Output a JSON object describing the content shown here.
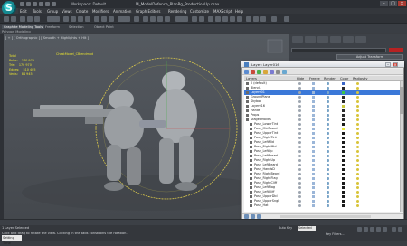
{
  "app": {
    "logo_letter": "S",
    "workspace": "Workspace: Default",
    "title": "M_ModelDefence_PlanPg_ProductionUp.max"
  },
  "menu": [
    "Edit",
    "Tools",
    "Group",
    "Views",
    "Create",
    "Modifiers",
    "Animation",
    "Graph Editors",
    "Rendering",
    "Customize",
    "MAXScript",
    "Help"
  ],
  "ribbon": {
    "tabs": [
      "Graphite Modeling Tools",
      "Freeform",
      "Selection",
      "Object Paint"
    ],
    "active": 0,
    "sublabel": "Polygon Modeling"
  },
  "viewport": {
    "label": "[ + ] [ Orthographic ] [ Smooth + Highlights + Hlt ]",
    "object_name": "ChestModel_CBlendmod",
    "stats": [
      {
        "label": "Total",
        "value": ""
      },
      {
        "label": "Polys:",
        "value": "170 970"
      },
      {
        "label": "Tris:",
        "value": "170 970"
      },
      {
        "label": "Edges:",
        "value": "510 405"
      },
      {
        "label": "Verts:",
        "value": "84 945"
      }
    ]
  },
  "command_panel": {
    "adjust_button": "Adjust Transform"
  },
  "layer_window": {
    "title": "Layer: Layer016",
    "columns": [
      "Layers",
      "Hide",
      "Freeze",
      "Render",
      "Color",
      "Radiosity"
    ],
    "rows": [
      {
        "name": "0 (default)",
        "indent": 0,
        "color": "#3a66c8"
      },
      {
        "name": "Blend1",
        "indent": 0,
        "color": "#2a2a2a"
      },
      {
        "name": "Layer001",
        "indent": 0,
        "color": "#3ac84a",
        "selected": true
      },
      {
        "name": "GroundPlane",
        "indent": 0,
        "color": "#2a2a2a"
      },
      {
        "name": "Skybox",
        "indent": 0,
        "color": "#2a2a2a"
      },
      {
        "name": "Layer016",
        "indent": 0,
        "color": "#c8c83a"
      },
      {
        "name": "Hands",
        "indent": 0,
        "color": "#2a2a2a"
      },
      {
        "name": "Props",
        "indent": 0,
        "color": "#2a2a2a"
      },
      {
        "name": "StagedMoves",
        "indent": 0,
        "color": "#2a2a2a"
      },
      {
        "name": "Pose_LowerTint",
        "indent": 1,
        "color": "#1a1a1a"
      },
      {
        "name": "Pose_MidPosed",
        "indent": 1,
        "color": "#e8e83a"
      },
      {
        "name": "Pose_UpperTint",
        "indent": 1,
        "color": "#1a1a1a"
      },
      {
        "name": "Pose_RightTint",
        "indent": 1,
        "color": "#1a1a1a"
      },
      {
        "name": "Pose_LeftMid",
        "indent": 1,
        "color": "#1a1a1a"
      },
      {
        "name": "Pose_RightMid",
        "indent": 1,
        "color": "#1a1a1a"
      },
      {
        "name": "Pose_LeftUp",
        "indent": 1,
        "color": "#1a1a1a"
      },
      {
        "name": "Pose_LeftPosed",
        "indent": 1,
        "color": "#1a1a1a"
      },
      {
        "name": "Pose_RightUp",
        "indent": 1,
        "color": "#1a1a1a"
      },
      {
        "name": "Pose_LeftBeard",
        "indent": 1,
        "color": "#1a1a1a"
      },
      {
        "name": "Pose_HandsD",
        "indent": 1,
        "color": "#1a1a1a"
      },
      {
        "name": "Pose_RightBeard",
        "indent": 1,
        "color": "#1a1a1a"
      },
      {
        "name": "Pose_RightFlag",
        "indent": 1,
        "color": "#1a1a1a"
      },
      {
        "name": "Pose_RightCliff",
        "indent": 1,
        "color": "#1a1a1a"
      },
      {
        "name": "Pose_LeftFlag",
        "indent": 1,
        "color": "#1a1a1a"
      },
      {
        "name": "Pose_LeftCliff",
        "indent": 1,
        "color": "#1a1a1a"
      },
      {
        "name": "Pose_UpperDbl",
        "indent": 1,
        "color": "#1a1a1a"
      },
      {
        "name": "Pose_UpperSngl",
        "indent": 1,
        "color": "#1a1a1a"
      },
      {
        "name": "Pose_Hat",
        "indent": 1,
        "color": "#1a1a1a"
      }
    ]
  },
  "status": {
    "selection": "1 Layer Selected",
    "hint": "Click and drag to rotate the view. Clicking in the tabs constrains the rotation.",
    "setting_button": "Setting Time",
    "autokey": "Auto Key",
    "selected_value": "Selected",
    "key_filters": "Key Filters..."
  }
}
